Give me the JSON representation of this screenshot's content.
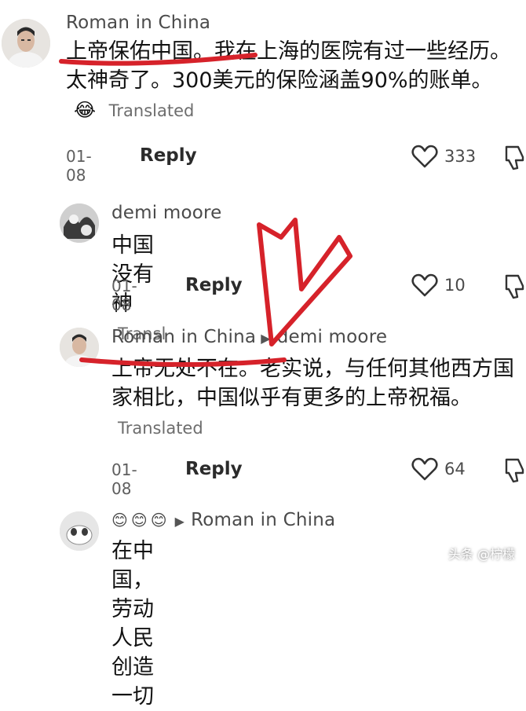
{
  "comments": [
    {
      "author": "Roman in China",
      "text": "上帝保佑中国。我在上海的医院有过一些经历。太神奇了。300美元的保险涵盖90%的账单。",
      "emoji": "😂",
      "translated": "Translated",
      "date": "01-08",
      "reply": "Reply",
      "likes": "333"
    },
    {
      "author": "demi moore",
      "text": "中国没有神",
      "translated": "Transl",
      "date": "01-08",
      "reply": "Reply",
      "likes": "10"
    },
    {
      "author": "Roman in China",
      "reply_to": "demi moore",
      "text": "上帝无处不在。老实说，与任何其他西方国家相比，中国似乎有更多的上帝祝福。",
      "translated": "Translated",
      "date": "01-08",
      "reply": "Reply",
      "likes": "64"
    },
    {
      "author_emojis": "😊😊😊",
      "reply_to": "Roman in China",
      "text": "在中国，劳动人民创造一切"
    }
  ],
  "watermark": "头条 @柠檬",
  "colors": {
    "annotation": "#d6222a",
    "heart": "#333333"
  }
}
